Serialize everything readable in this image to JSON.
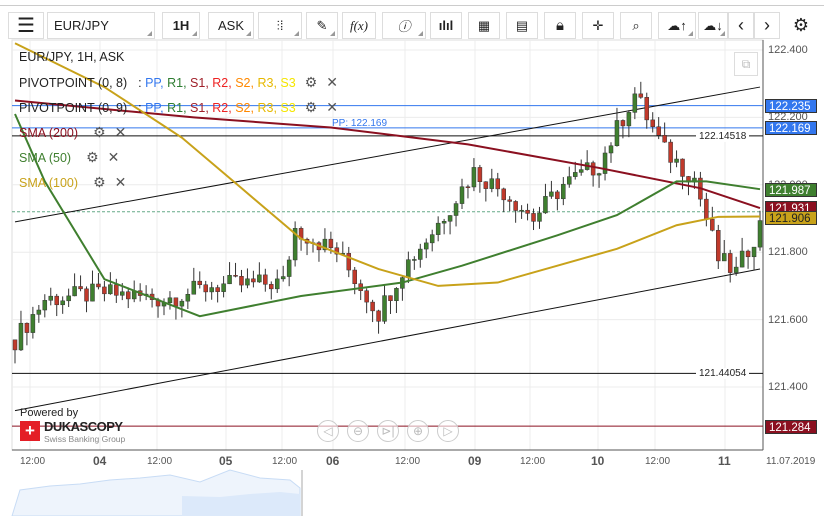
{
  "toolbar": {
    "menu_icon": "hamburger-icon",
    "symbol": "EUR/JPY",
    "timeframe": "1H",
    "side": "ASK",
    "icons": [
      "candles-icon",
      "pencil-icon",
      "function-icon",
      "info-icon",
      "volume-bars-icon",
      "calendar-icon",
      "report-icon",
      "lock-icon",
      "crosshair-icon",
      "zoom-search-icon",
      "upload-cloud-icon",
      "download-cloud-icon",
      "chevron-left-icon",
      "chevron-right-icon",
      "gear-icon"
    ],
    "function_label": "f(x)"
  },
  "legend": {
    "title": "EUR/JPY, 1H, ASK",
    "pivot1": "PIVOTPOINT (0, 8)",
    "pivot2": "PIVOTPOINT (0, 9)",
    "sep": " : ",
    "pivot_items": [
      {
        "t": "PP",
        "c": "#3377ee"
      },
      {
        "t": "R1",
        "c": "#2e7d32"
      },
      {
        "t": "S1",
        "c": "#a0202a"
      },
      {
        "t": "R2",
        "c": "#ee2222"
      },
      {
        "t": "S2",
        "c": "#ff8800"
      },
      {
        "t": "R3",
        "c": "#e6b800"
      },
      {
        "t": "S3",
        "c": "#f5e600"
      }
    ],
    "sma200": "SMA (200)",
    "sma50": "SMA (50)",
    "sma100": "SMA (100)"
  },
  "price_axis": {
    "labels": [
      "122.400",
      "122.200",
      "122.000",
      "121.800",
      "121.600",
      "121.400"
    ]
  },
  "tags": {
    "pp_r1": "122.235",
    "pp": "122.169",
    "sma50": "121.987",
    "sma200": "121.931",
    "sma100": "121.906",
    "low": "121.284"
  },
  "colors": {
    "blue": "#3377ee",
    "green": "#3f7f2f",
    "maroon": "#8b1020",
    "gold": "#c8a21a"
  },
  "annotations": {
    "pp_label": "PP: 122.169",
    "high_line": "122.14518",
    "low_line": "121.44054"
  },
  "time_axis": [
    "12:00",
    "04",
    "12:00",
    "05",
    "12:00",
    "06",
    "12:00",
    "09",
    "12:00",
    "10",
    "12:00",
    "11",
    "11.07.2019"
  ],
  "branding": {
    "powered": "Powered by",
    "name": "DUKASCOPY",
    "sub": "Swiss Banking Group"
  },
  "nav_icons": [
    "scroll-left-icon",
    "zoom-out-icon",
    "scroll-end-icon",
    "zoom-in-icon",
    "scroll-right-icon"
  ],
  "chart_data": {
    "type": "candlestick",
    "ylim": [
      121.2,
      122.43
    ],
    "x_range": [
      0,
      125
    ],
    "close_path": [
      [
        0,
        121.54
      ],
      [
        5,
        121.66
      ],
      [
        15,
        121.68
      ],
      [
        25,
        121.66
      ],
      [
        33,
        121.7
      ],
      [
        45,
        121.71
      ],
      [
        47,
        121.87
      ],
      [
        54,
        121.8
      ],
      [
        61,
        121.62
      ],
      [
        65,
        121.75
      ],
      [
        70,
        121.86
      ],
      [
        77,
        122.04
      ],
      [
        82,
        121.98
      ],
      [
        87,
        121.9
      ],
      [
        92,
        122.0
      ],
      [
        98,
        122.06
      ],
      [
        104,
        122.27
      ],
      [
        109,
        122.1
      ],
      [
        114,
        122.02
      ],
      [
        118,
        121.78
      ],
      [
        121,
        121.74
      ],
      [
        125,
        121.88
      ]
    ],
    "sma200": [
      [
        0,
        122.25
      ],
      [
        30,
        122.2
      ],
      [
        53,
        122.17
      ],
      [
        76,
        122.12
      ],
      [
        98,
        122.05
      ],
      [
        115,
        121.99
      ],
      [
        125,
        121.931
      ]
    ],
    "sma50": [
      [
        0,
        122.21
      ],
      [
        5,
        122.01
      ],
      [
        15,
        121.72
      ],
      [
        31,
        121.61
      ],
      [
        48,
        121.67
      ],
      [
        65,
        121.71
      ],
      [
        75,
        121.76
      ],
      [
        91,
        121.85
      ],
      [
        101,
        121.91
      ],
      [
        111,
        122.01
      ],
      [
        116,
        122.01
      ],
      [
        125,
        121.987
      ]
    ],
    "sma100": [
      [
        0,
        122.42
      ],
      [
        15,
        122.29
      ],
      [
        28,
        122.14
      ],
      [
        38,
        121.99
      ],
      [
        48,
        121.84
      ],
      [
        61,
        121.75
      ],
      [
        71,
        121.7
      ],
      [
        81,
        121.71
      ],
      [
        91,
        121.76
      ],
      [
        101,
        121.81
      ],
      [
        111,
        121.88
      ],
      [
        118,
        121.905
      ],
      [
        125,
        121.906
      ]
    ],
    "trend_upper": [
      [
        0,
        121.89
      ],
      [
        125,
        122.29
      ]
    ],
    "trend_lower": [
      [
        0,
        121.33
      ],
      [
        125,
        121.75
      ]
    ],
    "levels": {
      "r1": 122.235,
      "pp": 122.169,
      "high": 122.14518,
      "dashed": 121.92,
      "low": 121.44054,
      "s": 121.284
    }
  }
}
